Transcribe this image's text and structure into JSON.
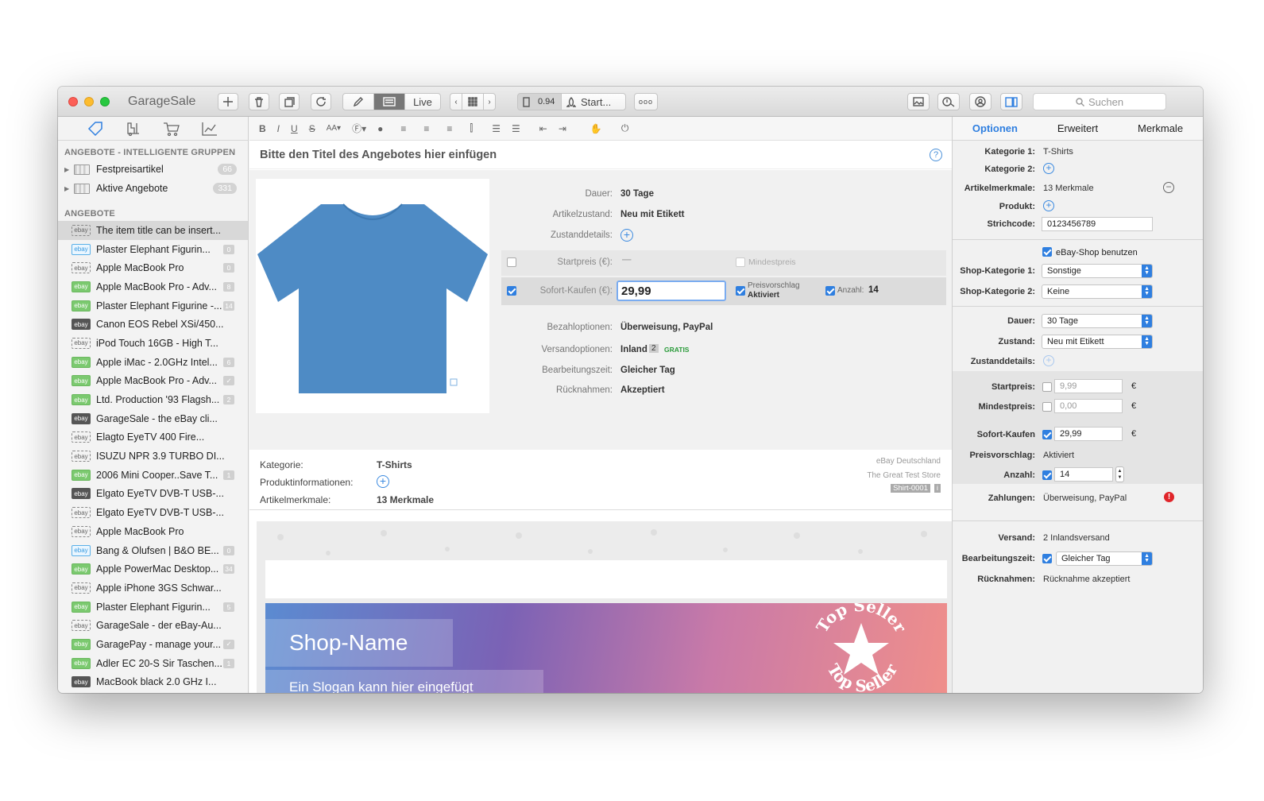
{
  "app": {
    "title": "GarageSale",
    "live": "Live",
    "zoom": "0.94",
    "start": "Start...",
    "more": "ooo",
    "search_placeholder": "Suchen"
  },
  "left": {
    "section1": "ANGEBOTE - INTELLIGENTE GRUPPEN",
    "groups": [
      {
        "label": "Festpreisartikel",
        "count": "66"
      },
      {
        "label": "Aktive Angebote",
        "count": "331"
      }
    ],
    "section2": "ANGEBOTE",
    "items": [
      {
        "label": "The item title can be insert...",
        "badge_style": "dashed",
        "badge": ""
      },
      {
        "label": "Plaster Elephant Figurin...",
        "badge_style": "blue",
        "badge": "0"
      },
      {
        "label": "Apple MacBook Pro",
        "badge_style": "dashed",
        "badge": "0"
      },
      {
        "label": "Apple MacBook Pro - Adv...",
        "badge_style": "green",
        "badge": "8"
      },
      {
        "label": "Plaster Elephant Figurine -...",
        "badge_style": "green",
        "badge": "14"
      },
      {
        "label": "Canon EOS Rebel XSi/450...",
        "badge_style": "dark",
        "badge": ""
      },
      {
        "label": "iPod Touch 16GB - High T...",
        "badge_style": "dashed",
        "badge": ""
      },
      {
        "label": "Apple iMac - 2.0GHz Intel...",
        "badge_style": "green",
        "badge": "6"
      },
      {
        "label": "Apple MacBook Pro - Adv...",
        "badge_style": "green",
        "badge": "✓"
      },
      {
        "label": "Ltd. Production '93 Flagsh...",
        "badge_style": "green",
        "badge": "2"
      },
      {
        "label": "GarageSale - the eBay cli...",
        "badge_style": "dark",
        "badge": ""
      },
      {
        "label": "Elagto EyeTV 400 Fire...",
        "badge_style": "dashed",
        "badge": ""
      },
      {
        "label": "ISUZU NPR 3.9 TURBO DI...",
        "badge_style": "dashed",
        "badge": ""
      },
      {
        "label": "2006 Mini Cooper..Save T...",
        "badge_style": "green",
        "badge": "1"
      },
      {
        "label": "Elgato EyeTV DVB-T USB-...",
        "badge_style": "dark",
        "badge": ""
      },
      {
        "label": "Elgato EyeTV DVB-T USB-...",
        "badge_style": "dashed",
        "badge": ""
      },
      {
        "label": "Apple MacBook Pro",
        "badge_style": "dashed",
        "badge": ""
      },
      {
        "label": "Bang & Olufsen | B&O BE...",
        "badge_style": "blue",
        "badge": "0"
      },
      {
        "label": "Apple PowerMac Desktop...",
        "badge_style": "green",
        "badge": "34"
      },
      {
        "label": "Apple iPhone 3GS Schwar...",
        "badge_style": "dashed",
        "badge": ""
      },
      {
        "label": "Plaster Elephant Figurin...",
        "badge_style": "green",
        "badge": "5"
      },
      {
        "label": "GarageSale - der eBay-Au...",
        "badge_style": "dashed",
        "badge": ""
      },
      {
        "label": "GaragePay - manage your...",
        "badge_style": "green",
        "badge": "✓"
      },
      {
        "label": "Adler EC 20-S Sir Taschen...",
        "badge_style": "green",
        "badge": "1"
      },
      {
        "label": "MacBook black 2.0 GHz I...",
        "badge_style": "dark",
        "badge": ""
      }
    ],
    "ebay_tag": "ebay"
  },
  "center": {
    "title_placeholder": "Bitte den Titel des Angebotes hier einfügen",
    "format": {
      "bold": "B",
      "italic": "I",
      "underline": "U",
      "strike": "S",
      "font_size": "AA▾",
      "font": "Ⓕ▾"
    },
    "fields": {
      "dauer_l": "Dauer:",
      "dauer_v": "30 Tage",
      "zustand_l": "Artikelzustand:",
      "zustand_v": "Neu mit Etikett",
      "zdet_l": "Zustanddetails:",
      "start_l": "Startpreis (€):",
      "start_v": "—",
      "mindest": "Mindestpreis",
      "sofort_l": "Sofort-Kaufen (€):",
      "sofort_v": "29,99",
      "preisv_l": "Preisvorschlag",
      "preisv_v": "Aktiviert",
      "anzahl_l": "Anzahl:",
      "anzahl_v": "14",
      "bezahl_l": "Bezahloptionen:",
      "bezahl_v": "Überweisung, PayPal",
      "versand_l": "Versandoptionen:",
      "versand_v": "Inland",
      "versand_n": "2",
      "versand_g": "GRATIS",
      "bearb_l": "Bearbeitungszeit:",
      "bearb_v": "Gleicher Tag",
      "rueck_l": "Rücknahmen:",
      "rueck_v": "Akzeptiert"
    },
    "meta": {
      "kat_l": "Kategorie:",
      "kat_v": "T-Shirts",
      "prod_l": "Produktinformationen:",
      "merk_l": "Artikelmerkmale:",
      "merk_v": "13 Merkmale",
      "site": "eBay Deutschland",
      "store": "The Great Test Store",
      "sku": "Shirt-0001",
      "sku_i": "i"
    },
    "template": {
      "shop": "Shop-Name",
      "slogan": "Ein Slogan kann hier eingefügt werden",
      "seal_top": "Top Seller",
      "seal_bottom": "Top Seller"
    },
    "help": "?"
  },
  "right": {
    "tabs": [
      "Optionen",
      "Erweitert",
      "Merkmale"
    ],
    "kat1_l": "Kategorie 1:",
    "kat1_v": "T-Shirts",
    "kat2_l": "Kategorie 2:",
    "merk_l": "Artikelmerkmale:",
    "merk_v": "13 Merkmale",
    "prod_l": "Produkt:",
    "ean_l": "Strichcode:",
    "ean_v": "0123456789",
    "shop_use": "eBay-Shop benutzen",
    "skat1_l": "Shop-Kategorie 1:",
    "skat1_v": "Sonstige",
    "skat2_l": "Shop-Kategorie 2:",
    "skat2_v": "Keine",
    "dauer_l": "Dauer:",
    "dauer_v": "30 Tage",
    "zustand_l": "Zustand:",
    "zustand_v": "Neu mit Etikett",
    "zdet_l": "Zustanddetails:",
    "start_l": "Startpreis:",
    "start_v": "9,99",
    "mind_l": "Mindestpreis:",
    "mind_v": "0,00",
    "sofort_l": "Sofort-Kaufen",
    "sofort_v": "29,99",
    "preisv_l": "Preisvorschlag:",
    "preisv_v": "Aktiviert",
    "anz_l": "Anzahl:",
    "anz_v": "14",
    "zahl_l": "Zahlungen:",
    "zahl_v": "Überweisung, PayPal",
    "vers_l": "Versand:",
    "vers_v": "2 Inlandsversand",
    "bearb_l": "Bearbeitungszeit:",
    "bearb_v": "Gleicher Tag",
    "rueck_l": "Rücknahmen:",
    "rueck_v": "Rücknahme akzeptiert",
    "euro": "€"
  }
}
